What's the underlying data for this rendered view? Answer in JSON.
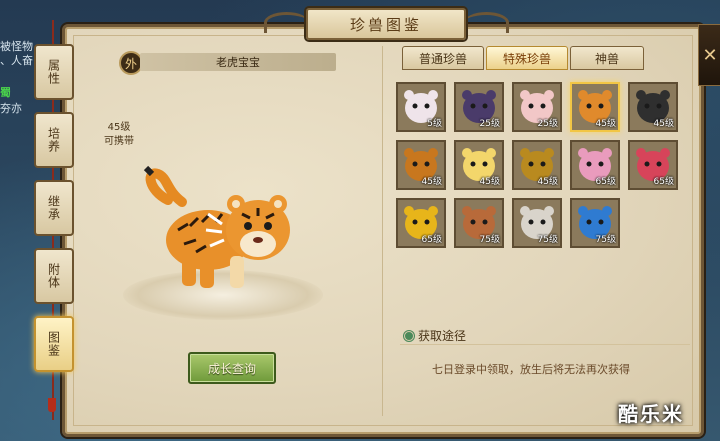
{
  "title": "珍兽图鉴",
  "background_fragments": [
    "被怪物",
    "、人奋",
    "蜀",
    "夯亦"
  ],
  "side_tabs": [
    {
      "label": "属性",
      "active": false
    },
    {
      "label": "培养",
      "active": false
    },
    {
      "label": "继承",
      "active": false
    },
    {
      "label": "附体",
      "active": false
    },
    {
      "label": "图鉴",
      "active": true
    }
  ],
  "pet": {
    "badge": "外",
    "name": "老虎宝宝",
    "level_label": "45级",
    "carry_label": "可携带"
  },
  "growth_button": "成长查询",
  "category_tabs": [
    {
      "label": "普通珍兽",
      "active": false
    },
    {
      "label": "特殊珍兽",
      "active": true
    },
    {
      "label": "神兽",
      "active": false
    }
  ],
  "pet_cells": [
    {
      "icon": "white-fox-icon",
      "level": "5级",
      "selected": false,
      "color": "#efe4ea"
    },
    {
      "icon": "armored-bull-icon",
      "level": "25级",
      "selected": false,
      "color": "#4a3b6a"
    },
    {
      "icon": "pink-cat-icon",
      "level": "25级",
      "selected": false,
      "color": "#f2c7c7"
    },
    {
      "icon": "tiger-icon",
      "level": "45级",
      "selected": true,
      "color": "#e08a2c"
    },
    {
      "icon": "panda-icon",
      "level": "45级",
      "selected": false,
      "color": "#2f2f2f"
    },
    {
      "icon": "brown-cow-icon",
      "level": "45级",
      "selected": false,
      "color": "#c8771e"
    },
    {
      "icon": "sheep-icon",
      "level": "45级",
      "selected": false,
      "color": "#f3d66b"
    },
    {
      "icon": "golden-dragon-icon",
      "level": "45级",
      "selected": false,
      "color": "#b98a1f"
    },
    {
      "icon": "pink-pig-icon",
      "level": "65级",
      "selected": false,
      "color": "#e99bbd"
    },
    {
      "icon": "santa-pig-icon",
      "level": "65级",
      "selected": false,
      "color": "#d7445a"
    },
    {
      "icon": "gold-bird-icon",
      "level": "65级",
      "selected": false,
      "color": "#e7b51a"
    },
    {
      "icon": "white-tiger-icon",
      "level": "75级",
      "selected": false,
      "color": "#b86a3a"
    },
    {
      "icon": "white-ape-icon",
      "level": "75级",
      "selected": false,
      "color": "#d9d4cb"
    },
    {
      "icon": "ice-dragon-icon",
      "level": "75级",
      "selected": false,
      "color": "#2f7bd1"
    }
  ],
  "acquire": {
    "title": "获取途径",
    "description": "七日登录中领取，放生后将无法再次获得"
  },
  "watermark": "酷乐米",
  "close_label": "✕"
}
